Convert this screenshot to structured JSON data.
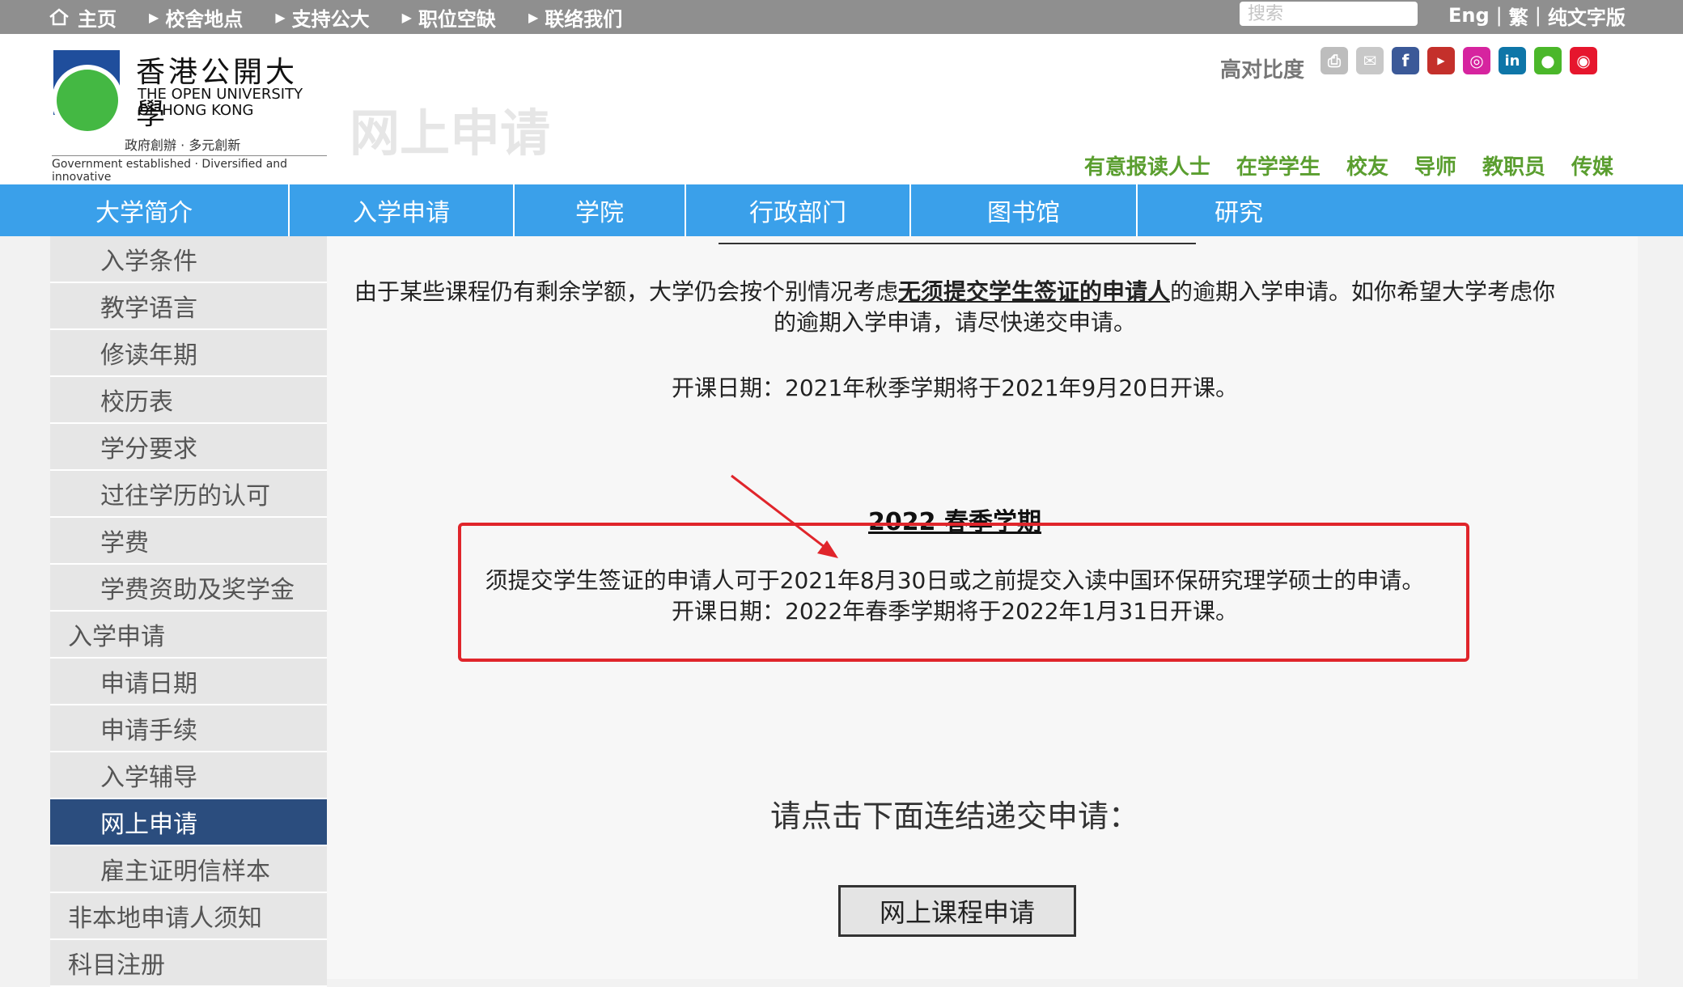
{
  "topbar": {
    "nav": [
      {
        "label": "主页",
        "icon": "home-icon"
      },
      {
        "label": "校舍地点"
      },
      {
        "label": "支持公大"
      },
      {
        "label": "职位空缺"
      },
      {
        "label": "联络我们"
      }
    ],
    "search_placeholder": "搜索",
    "lang_eng": "Eng",
    "lang_trad": "繁",
    "lang_text": "纯文字版"
  },
  "header": {
    "logo_cn": "香港公開大學",
    "logo_en_1": "THE OPEN UNIVERSITY",
    "logo_en_2": "OF HONG KONG",
    "logo_tagline_cn": "政府創辦 · 多元創新",
    "logo_tagline_en": "Government established · Diversified and innovative",
    "page_title": "网上申请",
    "contrast_label": "高对比度",
    "share_icons": [
      "print-icon",
      "email-icon",
      "facebook-icon",
      "youtube-icon",
      "instagram-icon",
      "linkedin-icon",
      "wechat-icon",
      "weibo-icon"
    ],
    "audience_links": [
      "有意报读人士",
      "在学学生",
      "校友",
      "导师",
      "教职员",
      "传媒"
    ]
  },
  "main_nav": [
    "大学简介",
    "入学申请",
    "学院",
    "行政部门",
    "图书馆",
    "研究"
  ],
  "sidebar": [
    {
      "label": "入学条件",
      "level": "sub"
    },
    {
      "label": "教学语言",
      "level": "sub"
    },
    {
      "label": "修读年期",
      "level": "sub"
    },
    {
      "label": "校历表",
      "level": "sub"
    },
    {
      "label": "学分要求",
      "level": "sub"
    },
    {
      "label": "过往学历的认可",
      "level": "sub"
    },
    {
      "label": "学费",
      "level": "sub"
    },
    {
      "label": "学费资助及奖学金",
      "level": "sub"
    },
    {
      "label": "入学申请",
      "level": "top"
    },
    {
      "label": "申请日期",
      "level": "sub"
    },
    {
      "label": "申请手续",
      "level": "sub"
    },
    {
      "label": "入学辅导",
      "level": "sub"
    },
    {
      "label": "网上申请",
      "level": "sub",
      "active": true
    },
    {
      "label": "雇主证明信样本",
      "level": "sub"
    },
    {
      "label": "非本地申请人须知",
      "level": "top"
    },
    {
      "label": "科目注册",
      "level": "top"
    }
  ],
  "content": {
    "late_para_pre": "由于某些课程仍有剩余学额，大学仍会按个别情况考虑",
    "late_para_bold": "无须提交学生签证的申请人",
    "late_para_post": "的逾期入学申请。如你希望大学考虑你的逾期入学申请，请尽快递交申请。",
    "autumn_start": "开课日期：2021年秋季学期将于2021年9月20日开课。",
    "spring_title": "2022 春季学期",
    "spring_line1": "须提交学生签证的申请人可于2021年8月30日或之前提交入读中国环保研究理学硕士的申请。",
    "spring_line2": "开课日期：2022年春季学期将于2022年1月31日开课。",
    "cta": "请点击下面连结递交申请：",
    "apply_button": "网上课程申请"
  },
  "colors": {
    "nav_blue": "#3aa0ea",
    "active_side": "#2b4d7e",
    "highlight_red": "#e0252b",
    "audience_green": "#5a9e2f"
  }
}
